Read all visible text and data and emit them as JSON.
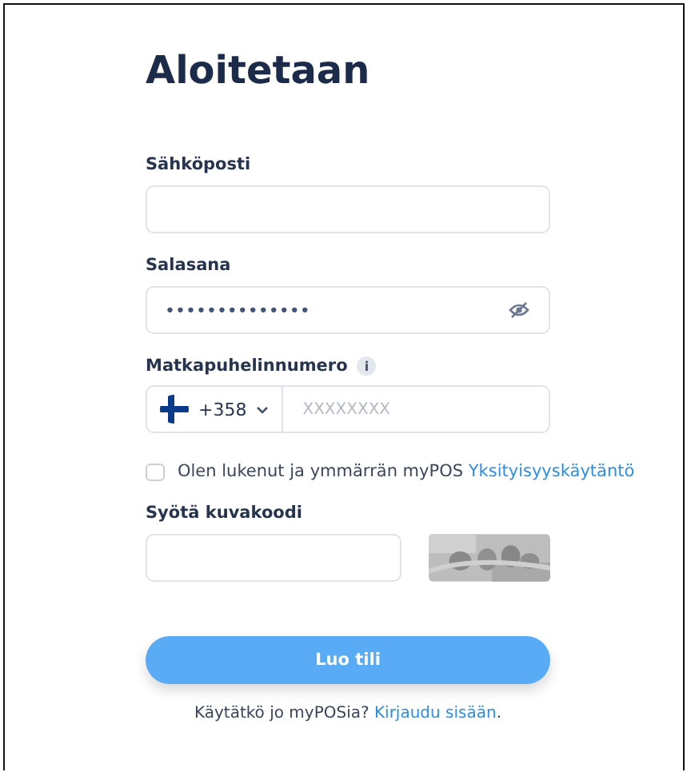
{
  "title": "Aloitetaan",
  "email": {
    "label": "Sähköposti"
  },
  "password": {
    "label": "Salasana",
    "value": "••••••••••••••"
  },
  "phone": {
    "label": "Matkapuhelinnumero",
    "info": "i",
    "code": "+358",
    "placeholder": "XXXXXXXX"
  },
  "consent": {
    "checked": false,
    "text": "Olen lukenut ja ymmärrän myPOS ",
    "link": "Yksityisyyskäytäntö"
  },
  "captcha": {
    "label": "Syötä kuvakoodi"
  },
  "submit": "Luo tili",
  "footer": {
    "text": "Käytätkö jo myPOSia? ",
    "link": "Kirjaudu sisään",
    "end": "."
  }
}
